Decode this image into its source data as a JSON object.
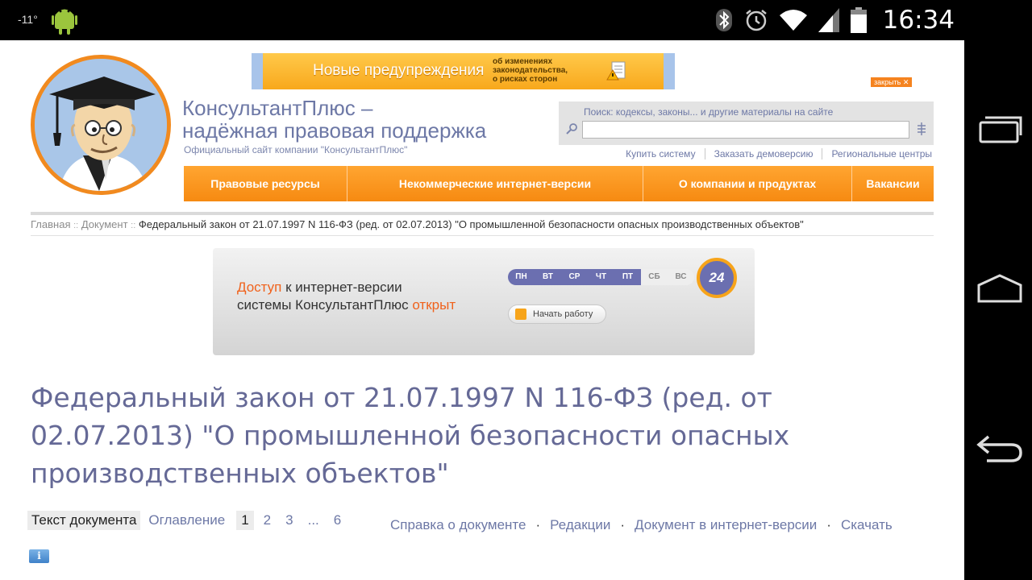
{
  "status_bar": {
    "temperature": "-11°",
    "time": "16:34"
  },
  "banner_top": {
    "main": "Новые предупреждения",
    "sub_line1": "об изменениях",
    "sub_line2": "законодательства,",
    "sub_line3": "о рисках сторон",
    "close_label": "закрыть ✕"
  },
  "header": {
    "title_line1": "КонсультантПлюс –",
    "title_line2": "надёжная правовая поддержка",
    "subtitle": "Официальный сайт компании \"КонсультантПлюс\""
  },
  "search": {
    "label": "Поиск: кодексы, законы... и другие материалы на сайте",
    "value": ""
  },
  "top_links": [
    "Купить систему",
    "Заказать демоверсию",
    "Региональные центры"
  ],
  "menu": [
    "Правовые ресурсы",
    "Некоммерческие интернет-версии",
    "О компании и продуктах",
    "Вакансии"
  ],
  "breadcrumb": {
    "home": "Главная",
    "sep": "::",
    "document": "Документ",
    "current": "Федеральный закон от 21.07.1997 N 116-ФЗ (ред. от 02.07.2013) \"О промышленной безопасности опасных производственных объектов\""
  },
  "promo": {
    "word1": "Доступ",
    "text1": " к интернет-версии",
    "text2": "системы КонсультантПлюс ",
    "word2": "открыт",
    "days_week": [
      "ПН",
      "ВТ",
      "СР",
      "ЧТ",
      "ПТ"
    ],
    "days_weekend": [
      "СБ",
      "ВС"
    ],
    "badge": "24",
    "start_label": "Начать работу"
  },
  "document": {
    "title": "Федеральный закон от 21.07.1997 N 116-ФЗ (ред. от 02.07.2013) \"О промышленной безопасности опасных производственных объектов\""
  },
  "tabs": {
    "text": "Текст документа",
    "toc": "Оглавление",
    "pages": [
      "1",
      "2",
      "3",
      "...",
      "6"
    ]
  },
  "doc_links": [
    "Справка о документе",
    "Редакции",
    "Документ в интернет-версии",
    "Скачать"
  ],
  "info_icon_label": "i"
}
